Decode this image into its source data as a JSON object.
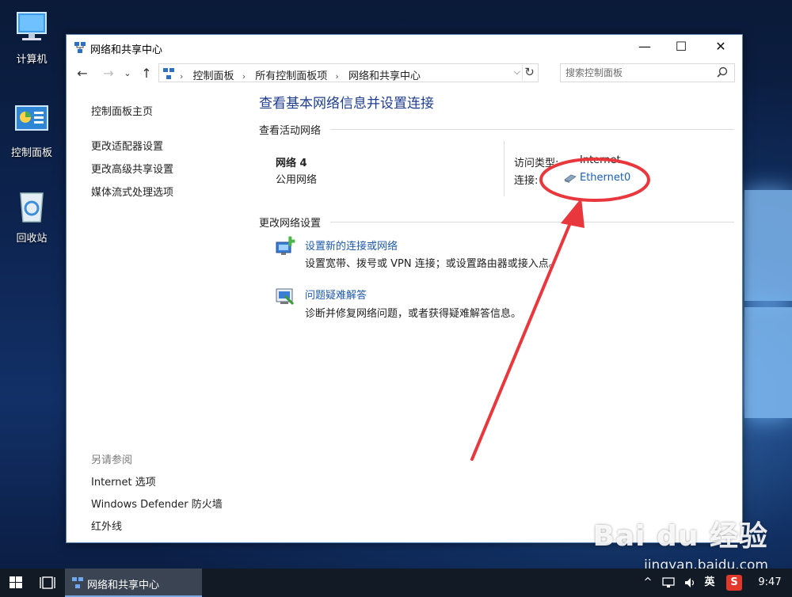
{
  "desktop": {
    "icons": [
      {
        "label": "计算机"
      },
      {
        "label": "控制面板"
      },
      {
        "label": "回收站"
      }
    ]
  },
  "window": {
    "title": "网络和共享中心",
    "controls": {
      "minimize": "—",
      "maximize": "☐",
      "close": "✕"
    },
    "address": {
      "crumbs": [
        "控制面板",
        "所有控制面板项",
        "网络和共享中心"
      ],
      "search_placeholder": "搜索控制面板"
    },
    "left_pane": {
      "links": [
        "控制面板主页",
        "更改适配器设置",
        "更改高级共享设置",
        "媒体流式处理选项"
      ],
      "see_also_heading": "另请参阅",
      "see_also_links": [
        "Internet 选项",
        "Windows Defender 防火墙",
        "红外线"
      ]
    },
    "main": {
      "title": "查看基本网络信息并设置连接",
      "active_networks_heading": "查看活动网络",
      "network": {
        "name": "网络 4",
        "type": "公用网络",
        "access_type_label": "访问类型:",
        "access_type_value": "Internet",
        "connection_label": "连接:",
        "connection_value": "Ethernet0"
      },
      "change_settings_heading": "更改网络设置",
      "tasks": [
        {
          "link": "设置新的连接或网络",
          "desc": "设置宽带、拨号或 VPN 连接；或设置路由器或接入点。"
        },
        {
          "link": "问题疑难解答",
          "desc": "诊断并修复网络问题，或者获得疑难解答信息。"
        }
      ]
    }
  },
  "annotation": {
    "color": "#e8383d"
  },
  "watermark": {
    "logo": "Bai du 经验",
    "url": "jingyan.baidu.com"
  },
  "taskbar": {
    "app_label": "网络和共享中心",
    "ime": "英",
    "time": "9:47"
  }
}
